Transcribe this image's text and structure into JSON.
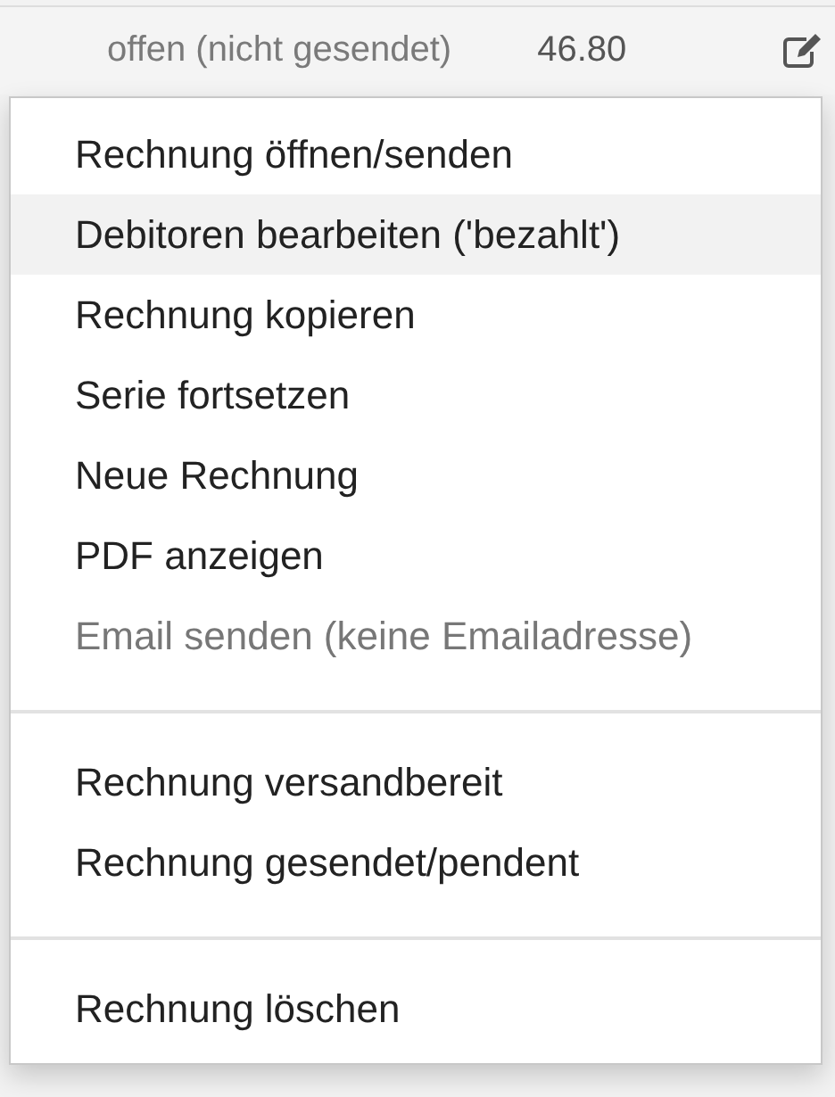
{
  "row": {
    "status": "offen (nicht gesendet)",
    "amount": "46.80"
  },
  "menu": {
    "groups": [
      {
        "items": [
          {
            "label": "Rechnung öffnen/senden",
            "highlighted": false,
            "disabled": false
          },
          {
            "label": "Debitoren bearbeiten ('bezahlt')",
            "highlighted": true,
            "disabled": false
          },
          {
            "label": "Rechnung kopieren",
            "highlighted": false,
            "disabled": false
          },
          {
            "label": "Serie fortsetzen",
            "highlighted": false,
            "disabled": false
          },
          {
            "label": "Neue Rechnung",
            "highlighted": false,
            "disabled": false
          },
          {
            "label": "PDF anzeigen",
            "highlighted": false,
            "disabled": false
          },
          {
            "label": "Email senden (keine Emailadresse)",
            "highlighted": false,
            "disabled": true
          }
        ]
      },
      {
        "items": [
          {
            "label": "Rechnung versandbereit",
            "highlighted": false,
            "disabled": false
          },
          {
            "label": "Rechnung gesendet/pendent",
            "highlighted": false,
            "disabled": false
          }
        ]
      },
      {
        "items": [
          {
            "label": "Rechnung löschen",
            "highlighted": false,
            "disabled": false
          }
        ]
      }
    ]
  }
}
